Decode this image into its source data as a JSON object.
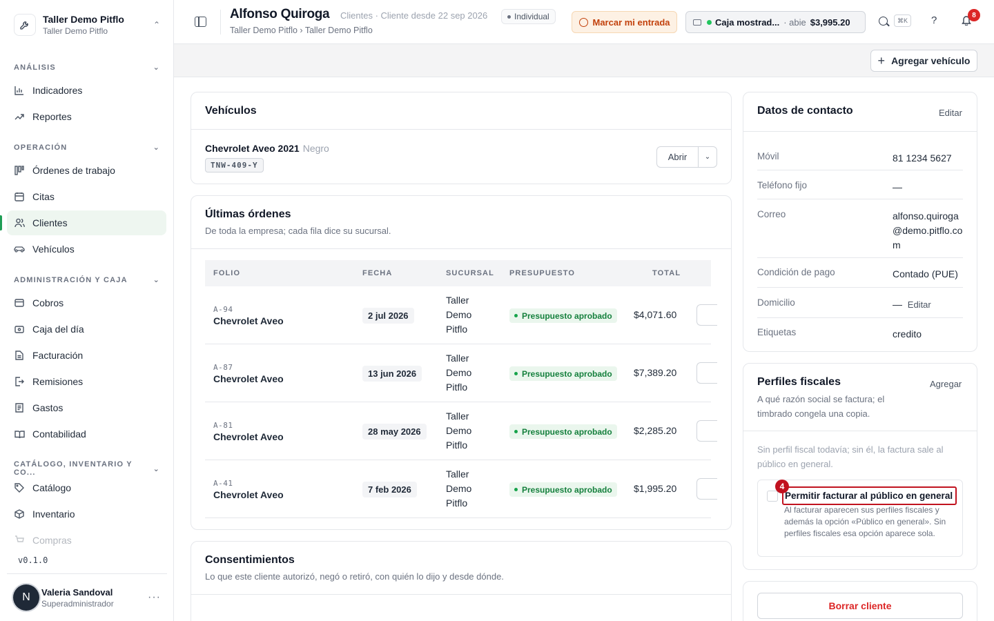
{
  "org": {
    "name": "Taller Demo Pitflo",
    "sub": "Taller Demo Pitflo"
  },
  "nav": {
    "sections": {
      "analisis": "ANÁLISIS",
      "operacion": "OPERACIÓN",
      "admin": "ADMINISTRACIÓN Y CAJA",
      "catalogo": "CATÁLOGO, INVENTARIO Y CO..."
    },
    "items": {
      "indicadores": "Indicadores",
      "reportes": "Reportes",
      "ordenes": "Órdenes de trabajo",
      "citas": "Citas",
      "clientes": "Clientes",
      "vehiculos": "Vehículos",
      "cobros": "Cobros",
      "caja": "Caja del día",
      "facturacion": "Facturación",
      "remisiones": "Remisiones",
      "gastos": "Gastos",
      "contabilidad": "Contabilidad",
      "catalogo": "Catálogo",
      "inventario": "Inventario",
      "compras": "Compras"
    }
  },
  "version": "v0.1.0",
  "user": {
    "initial": "N",
    "name": "Valeria Sandoval",
    "role": "Superadministrador"
  },
  "header": {
    "title": "Alfonso Quiroga",
    "meta": "Clientes · Cliente desde 22 sep 2026",
    "badge": "Individual",
    "breadcrumb": "Taller Demo Pitflo › Taller Demo Pitflo",
    "clock_in": "Marcar mi entrada",
    "register_name": "Caja mostrad...",
    "register_status": "· abie",
    "register_amount": "$3,995.20",
    "shortcut": "⌘K",
    "notifications": "8"
  },
  "actions": {
    "add_vehicle": "Agregar vehículo"
  },
  "vehicles": {
    "title": "Vehículos",
    "items": [
      {
        "name": "Chevrolet Aveo 2021",
        "color": "Negro",
        "plate": "TNW-409-Y",
        "open_label": "Abrir"
      }
    ]
  },
  "orders": {
    "title": "Últimas órdenes",
    "subtitle": "De toda la empresa; cada fila dice su sucursal.",
    "columns": [
      "FOLIO",
      "FECHA",
      "SUCURSAL",
      "PRESUPUESTO",
      "TOTAL"
    ],
    "rows": [
      {
        "folio": "A-94",
        "model": "Chevrolet Aveo",
        "date": "2 jul 2026",
        "branch": [
          "Taller",
          "Demo",
          "Pitflo"
        ],
        "budget": "Presupuesto aprobado",
        "total": "$4,071.60"
      },
      {
        "folio": "A-87",
        "model": "Chevrolet Aveo",
        "date": "13 jun 2026",
        "branch": [
          "Taller",
          "Demo",
          "Pitflo"
        ],
        "budget": "Presupuesto aprobado",
        "total": "$7,389.20"
      },
      {
        "folio": "A-81",
        "model": "Chevrolet Aveo",
        "date": "28 may 2026",
        "branch": [
          "Taller",
          "Demo",
          "Pitflo"
        ],
        "budget": "Presupuesto aprobado",
        "total": "$2,285.20"
      },
      {
        "folio": "A-41",
        "model": "Chevrolet Aveo",
        "date": "7 feb 2026",
        "branch": [
          "Taller",
          "Demo",
          "Pitflo"
        ],
        "budget": "Presupuesto aprobado",
        "total": "$1,995.20"
      }
    ]
  },
  "consents": {
    "title": "Consentimientos",
    "subtitle": "Lo que este cliente autorizó, negó o retiró, con quién lo dijo y desde dónde."
  },
  "contact": {
    "title": "Datos de contacto",
    "edit": "Editar",
    "fields": {
      "movil_k": "Móvil",
      "movil_v": "81 1234 5627",
      "fijo_k": "Teléfono fijo",
      "fijo_v": "—",
      "correo_k": "Correo",
      "correo_v": "alfonso.quiroga@demo.pitflo.com",
      "pago_k": "Condición de pago",
      "pago_v": "Contado (PUE)",
      "domicilio_k": "Domicilio",
      "domicilio_v": "—",
      "domicilio_edit": "Editar",
      "etiquetas_k": "Etiquetas",
      "etiquetas_v": "credito"
    }
  },
  "fiscal": {
    "title": "Perfiles fiscales",
    "add": "Agregar",
    "subtitle": "A qué razón social se factura; el timbrado congela una copia.",
    "empty": "Sin perfil fiscal todavía; sin él, la factura sale al público en general.",
    "step": "4",
    "checkbox_label": "Permitir facturar al público en general",
    "checkbox_desc": "Al facturar aparecen sus perfiles fiscales y además la opción «Público en general». Sin perfiles fiscales esa opción aparece sola."
  },
  "danger": {
    "delete": "Borrar cliente"
  }
}
